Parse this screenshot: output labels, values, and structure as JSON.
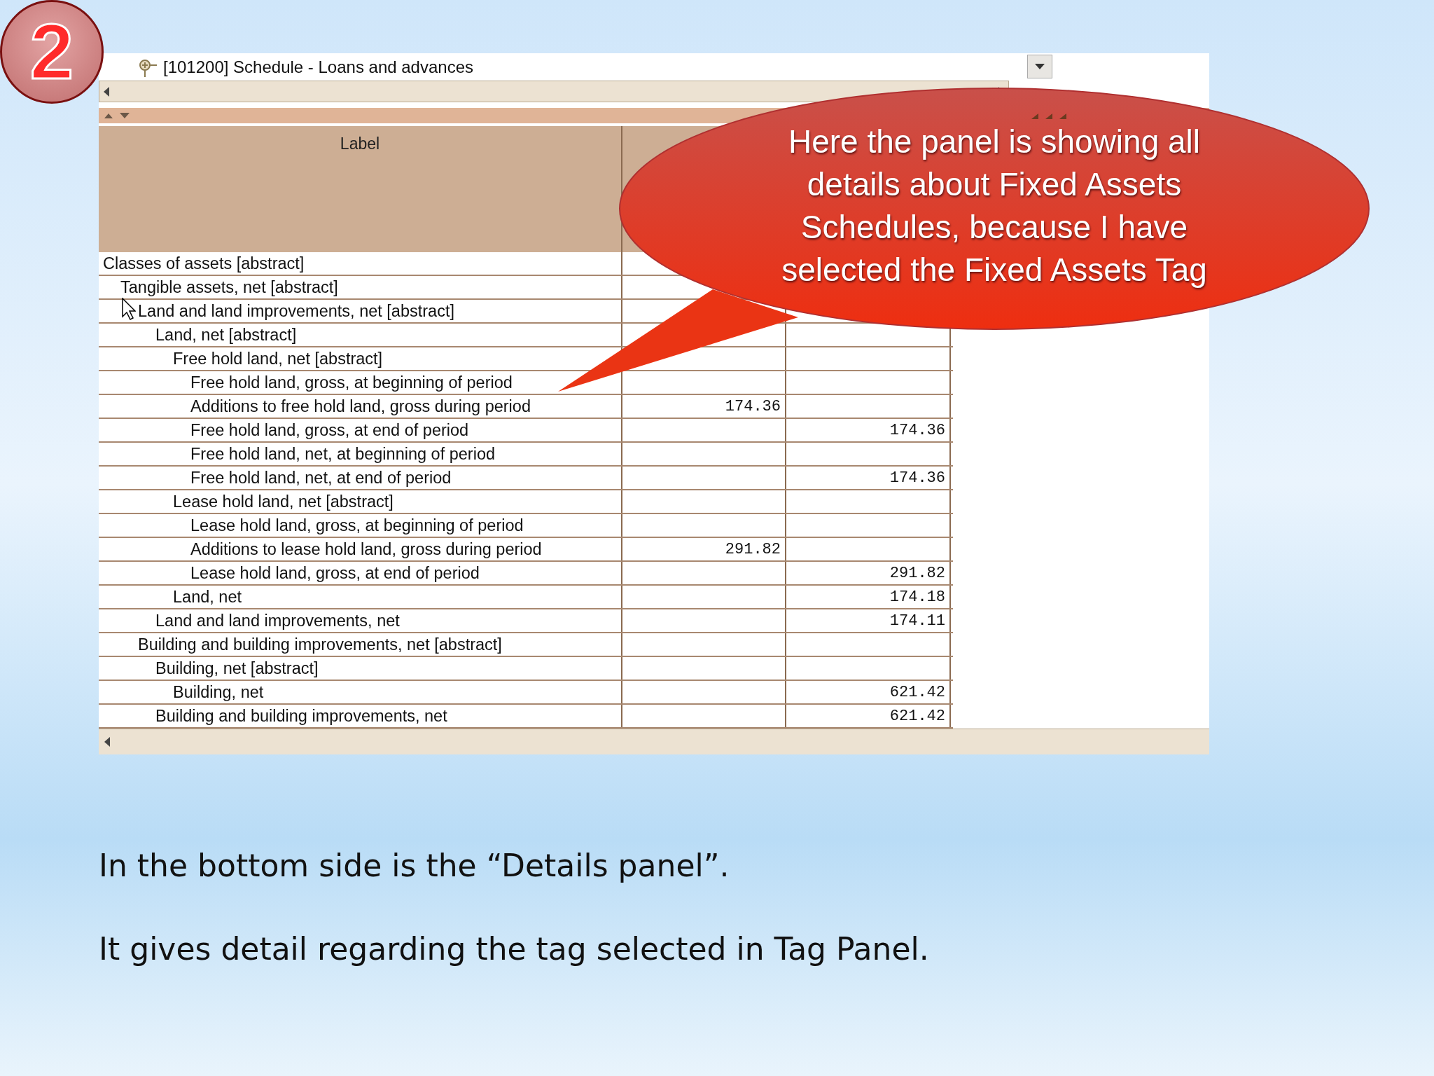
{
  "slide_number": "2",
  "app": {
    "tree_item": "[101200] Schedule - Loans and advances",
    "table": {
      "columns": [
        {
          "lines": [
            "Label"
          ]
        }
      ],
      "rows": [
        {
          "label": "Classes of assets [abstract]",
          "children": [
            {
              "label": "Tangible assets, net [abstract]",
              "children": [
                {
                  "label": "Land and land improvements, net [abstract]",
                  "children": [
                    {
                      "label": "Land, net [abstract]",
                      "children": [
                        {
                          "label": "Free hold land, net [abstract]",
                          "children": [
                            {
                              "label": "Free hold land, gross, at beginning of period"
                            },
                            {
                              "label": "Additions to free hold land, gross during period",
                              "during": "174.36"
                            },
                            {
                              "label": "Free hold land, gross, at end of period",
                              "as_of": "174.36"
                            },
                            {
                              "label": "Free hold land, net, at beginning of period"
                            },
                            {
                              "label": "Free hold land, net, at end of period",
                              "as_of": "174.36"
                            }
                          ]
                        },
                        {
                          "label": "Lease hold land, net [abstract]",
                          "children": [
                            {
                              "label": "Lease hold land, gross, at beginning of period"
                            },
                            {
                              "label": "Additions to lease hold land, gross during period",
                              "during": "291.82"
                            },
                            {
                              "label": "Lease hold land, gross, at end of period",
                              "as_of": "291.82"
                            }
                          ]
                        },
                        {
                          "label": "Land, net",
                          "as_of": "174.18"
                        }
                      ]
                    },
                    {
                      "label": "Land and land improvements, net",
                      "as_of": "174.11"
                    }
                  ]
                },
                {
                  "label": "Building and building improvements, net [abstract]",
                  "children": [
                    {
                      "label": "Building, net [abstract]",
                      "children": [
                        {
                          "label": "Building, net",
                          "as_of": "621.42"
                        }
                      ]
                    },
                    {
                      "label": "Building and building improvements, net",
                      "as_of": "621.42"
                    }
                  ]
                }
              ]
            }
          ]
        }
      ]
    }
  },
  "callout": {
    "lines": [
      "Here the panel is showing all",
      "details about Fixed Assets",
      "Schedules, because I have",
      "selected the Fixed Assets Tag"
    ]
  },
  "paragraphs": [
    "In the bottom side is the “Details panel”.",
    "It gives detail regarding the tag selected in Tag Panel."
  ]
}
